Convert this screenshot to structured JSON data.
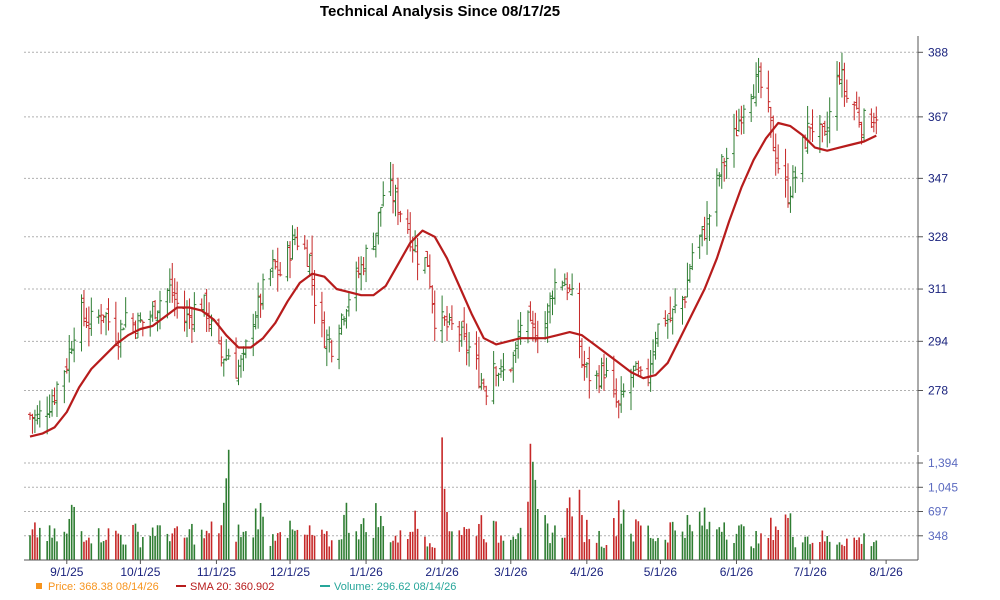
{
  "chart_data": {
    "type": "ohlc",
    "title": "Technical Analysis Since 08/17/25",
    "price_axis": {
      "ticks": [
        278,
        294,
        311,
        328,
        347,
        367,
        388
      ],
      "ylim": [
        258,
        392
      ]
    },
    "volume_axis": {
      "ticks": [
        348,
        697,
        1045,
        1394
      ],
      "tick_labels": [
        "348",
        "697",
        "1,045",
        "1,394"
      ],
      "ylim": [
        0,
        1394
      ]
    },
    "x_ticks": [
      "9/1/25",
      "10/1/25",
      "11/1/25",
      "12/1/25",
      "1/1/26",
      "2/1/26",
      "3/1/26",
      "4/1/26",
      "5/1/26",
      "6/1/26",
      "7/1/26",
      "8/1/26"
    ],
    "x_tick_days": [
      15,
      45,
      76,
      106,
      137,
      168,
      196,
      227,
      257,
      288,
      318,
      349
    ],
    "day_range": [
      0,
      362
    ],
    "price_close": [
      [
        0,
        270
      ],
      [
        3,
        269
      ],
      [
        6,
        272
      ],
      [
        9,
        275
      ],
      [
        12,
        282
      ],
      [
        15,
        287
      ],
      [
        18,
        298
      ],
      [
        21,
        303
      ],
      [
        24,
        300
      ],
      [
        27,
        301
      ],
      [
        30,
        304
      ],
      [
        33,
        299
      ],
      [
        36,
        296
      ],
      [
        39,
        303
      ],
      [
        42,
        300
      ],
      [
        45,
        300
      ],
      [
        48,
        301
      ],
      [
        51,
        305
      ],
      [
        54,
        309
      ],
      [
        57,
        311
      ],
      [
        60,
        306
      ],
      [
        63,
        301
      ],
      [
        66,
        303
      ],
      [
        69,
        308
      ],
      [
        72,
        304
      ],
      [
        75,
        295
      ],
      [
        78,
        289
      ],
      [
        81,
        290
      ],
      [
        84,
        285
      ],
      [
        87,
        287
      ],
      [
        90,
        301
      ],
      [
        93,
        305
      ],
      [
        96,
        313
      ],
      [
        99,
        318
      ],
      [
        102,
        316
      ],
      [
        105,
        322
      ],
      [
        108,
        328
      ],
      [
        111,
        325
      ],
      [
        114,
        321
      ],
      [
        117,
        302
      ],
      [
        120,
        296
      ],
      [
        123,
        293
      ],
      [
        126,
        300
      ],
      [
        129,
        307
      ],
      [
        132,
        313
      ],
      [
        135,
        318
      ],
      [
        138,
        324
      ],
      [
        141,
        330
      ],
      [
        144,
        342
      ],
      [
        147,
        343
      ],
      [
        150,
        338
      ],
      [
        153,
        334
      ],
      [
        156,
        326
      ],
      [
        159,
        320
      ],
      [
        162,
        320
      ],
      [
        165,
        302
      ],
      [
        168,
        300
      ],
      [
        171,
        298
      ],
      [
        174,
        299
      ],
      [
        177,
        293
      ],
      [
        180,
        291
      ],
      [
        183,
        283
      ],
      [
        186,
        279
      ],
      [
        189,
        288
      ],
      [
        192,
        283
      ],
      [
        195,
        285
      ],
      [
        198,
        290
      ],
      [
        201,
        305
      ],
      [
        204,
        297
      ],
      [
        207,
        298
      ],
      [
        210,
        300
      ],
      [
        213,
        311
      ],
      [
        216,
        316
      ],
      [
        219,
        312
      ],
      [
        222,
        305
      ],
      [
        225,
        287
      ],
      [
        228,
        283
      ],
      [
        231,
        282
      ],
      [
        234,
        285
      ],
      [
        237,
        277
      ],
      [
        240,
        272
      ],
      [
        243,
        279
      ],
      [
        246,
        284
      ],
      [
        249,
        281
      ],
      [
        252,
        284
      ],
      [
        255,
        297
      ],
      [
        258,
        302
      ],
      [
        261,
        301
      ],
      [
        264,
        306
      ],
      [
        267,
        309
      ],
      [
        270,
        323
      ],
      [
        273,
        327
      ],
      [
        276,
        332
      ],
      [
        279,
        342
      ],
      [
        282,
        351
      ],
      [
        285,
        355
      ],
      [
        288,
        363
      ],
      [
        291,
        372
      ],
      [
        294,
        377
      ],
      [
        297,
        378
      ],
      [
        300,
        373
      ],
      [
        303,
        358
      ],
      [
        306,
        348
      ],
      [
        309,
        342
      ],
      [
        312,
        348
      ],
      [
        315,
        357
      ],
      [
        318,
        365
      ],
      [
        321,
        362
      ],
      [
        324,
        359
      ],
      [
        327,
        372
      ],
      [
        330,
        382
      ],
      [
        333,
        373
      ],
      [
        336,
        371
      ],
      [
        339,
        365
      ],
      [
        342,
        366
      ],
      [
        345,
        368.38
      ]
    ],
    "sma20": [
      [
        0,
        263
      ],
      [
        5,
        264
      ],
      [
        10,
        266
      ],
      [
        15,
        271
      ],
      [
        20,
        279
      ],
      [
        25,
        285
      ],
      [
        30,
        289
      ],
      [
        35,
        293
      ],
      [
        40,
        296
      ],
      [
        45,
        298
      ],
      [
        50,
        299
      ],
      [
        55,
        302
      ],
      [
        60,
        305
      ],
      [
        65,
        305
      ],
      [
        70,
        304
      ],
      [
        75,
        301
      ],
      [
        80,
        296
      ],
      [
        85,
        292
      ],
      [
        90,
        292
      ],
      [
        95,
        295
      ],
      [
        100,
        300
      ],
      [
        105,
        307
      ],
      [
        110,
        313
      ],
      [
        115,
        316
      ],
      [
        120,
        315
      ],
      [
        125,
        311
      ],
      [
        130,
        310
      ],
      [
        135,
        309
      ],
      [
        140,
        309
      ],
      [
        145,
        312
      ],
      [
        150,
        319
      ],
      [
        155,
        326
      ],
      [
        160,
        330
      ],
      [
        165,
        328
      ],
      [
        170,
        321
      ],
      [
        175,
        312
      ],
      [
        180,
        303
      ],
      [
        185,
        295
      ],
      [
        190,
        293
      ],
      [
        195,
        294
      ],
      [
        200,
        295
      ],
      [
        205,
        295
      ],
      [
        210,
        295
      ],
      [
        215,
        296
      ],
      [
        220,
        297
      ],
      [
        225,
        296
      ],
      [
        230,
        293
      ],
      [
        235,
        290
      ],
      [
        240,
        287
      ],
      [
        245,
        284
      ],
      [
        250,
        282
      ],
      [
        255,
        283
      ],
      [
        260,
        287
      ],
      [
        265,
        295
      ],
      [
        270,
        303
      ],
      [
        275,
        311
      ],
      [
        280,
        321
      ],
      [
        285,
        333
      ],
      [
        290,
        344
      ],
      [
        295,
        353
      ],
      [
        300,
        360
      ],
      [
        305,
        365
      ],
      [
        310,
        364
      ],
      [
        315,
        361
      ],
      [
        320,
        357
      ],
      [
        325,
        356
      ],
      [
        330,
        357
      ],
      [
        335,
        358
      ],
      [
        340,
        359
      ],
      [
        345,
        360.902
      ]
    ],
    "volume": [
      [
        0,
        300
      ],
      [
        3,
        420
      ],
      [
        6,
        380
      ],
      [
        9,
        330
      ],
      [
        12,
        310
      ],
      [
        15,
        360
      ],
      [
        18,
        780
      ],
      [
        21,
        410
      ],
      [
        24,
        450
      ],
      [
        27,
        300
      ],
      [
        30,
        420
      ],
      [
        33,
        340
      ],
      [
        36,
        380
      ],
      [
        39,
        310
      ],
      [
        42,
        400
      ],
      [
        45,
        330
      ],
      [
        48,
        350
      ],
      [
        51,
        480
      ],
      [
        54,
        300
      ],
      [
        57,
        420
      ],
      [
        60,
        340
      ],
      [
        63,
        290
      ],
      [
        66,
        410
      ],
      [
        69,
        360
      ],
      [
        72,
        330
      ],
      [
        75,
        450
      ],
      [
        78,
        520
      ],
      [
        81,
        1150
      ],
      [
        84,
        420
      ],
      [
        87,
        360
      ],
      [
        90,
        300
      ],
      [
        93,
        780
      ],
      [
        96,
        380
      ],
      [
        99,
        330
      ],
      [
        102,
        610
      ],
      [
        105,
        400
      ],
      [
        108,
        380
      ],
      [
        111,
        300
      ],
      [
        114,
        360
      ],
      [
        117,
        320
      ],
      [
        120,
        310
      ],
      [
        123,
        250
      ],
      [
        126,
        370
      ],
      [
        129,
        640
      ],
      [
        132,
        520
      ],
      [
        135,
        470
      ],
      [
        138,
        410
      ],
      [
        141,
        630
      ],
      [
        144,
        450
      ],
      [
        147,
        380
      ],
      [
        150,
        300
      ],
      [
        153,
        330
      ],
      [
        156,
        590
      ],
      [
        159,
        420
      ],
      [
        162,
        350
      ],
      [
        165,
        300
      ],
      [
        168,
        1230
      ],
      [
        171,
        560
      ],
      [
        174,
        480
      ],
      [
        177,
        420
      ],
      [
        180,
        380
      ],
      [
        183,
        600
      ],
      [
        186,
        420
      ],
      [
        189,
        420
      ],
      [
        192,
        330
      ],
      [
        195,
        500
      ],
      [
        198,
        440
      ],
      [
        201,
        740
      ],
      [
        204,
        1200
      ],
      [
        207,
        600
      ],
      [
        210,
        470
      ],
      [
        213,
        400
      ],
      [
        216,
        360
      ],
      [
        219,
        600
      ],
      [
        222,
        1150
      ],
      [
        225,
        490
      ],
      [
        228,
        420
      ],
      [
        231,
        350
      ],
      [
        234,
        300
      ],
      [
        237,
        260
      ],
      [
        240,
        800
      ],
      [
        243,
        690
      ],
      [
        246,
        370
      ],
      [
        249,
        520
      ],
      [
        252,
        410
      ],
      [
        255,
        330
      ],
      [
        258,
        300
      ],
      [
        261,
        470
      ],
      [
        264,
        440
      ],
      [
        267,
        560
      ],
      [
        270,
        370
      ],
      [
        273,
        600
      ],
      [
        276,
        500
      ],
      [
        279,
        400
      ],
      [
        282,
        620
      ],
      [
        285,
        470
      ],
      [
        288,
        400
      ],
      [
        291,
        380
      ],
      [
        294,
        310
      ],
      [
        297,
        280
      ],
      [
        300,
        270
      ],
      [
        303,
        520
      ],
      [
        306,
        520
      ],
      [
        309,
        600
      ],
      [
        312,
        300
      ],
      [
        315,
        420
      ],
      [
        318,
        290
      ],
      [
        321,
        350
      ],
      [
        324,
        290
      ],
      [
        327,
        280
      ],
      [
        330,
        300
      ],
      [
        333,
        310
      ],
      [
        336,
        280
      ],
      [
        339,
        300
      ],
      [
        342,
        300
      ],
      [
        345,
        296.62
      ]
    ],
    "legend": [
      {
        "label": "Price: 368.38  08/14/26",
        "color": "#f7941d",
        "marker": "square"
      },
      {
        "label": "SMA 20: 360.902",
        "color": "#b71c1c",
        "marker": "line"
      },
      {
        "label": "Volume: 296.62  08/14/26",
        "color": "#26a69a",
        "marker": "line"
      }
    ],
    "colors": {
      "up": "#2e7d32",
      "down": "#c62828",
      "sma": "#b71c1c",
      "volume_up": "#2e7d32",
      "volume_down": "#c62828"
    }
  }
}
